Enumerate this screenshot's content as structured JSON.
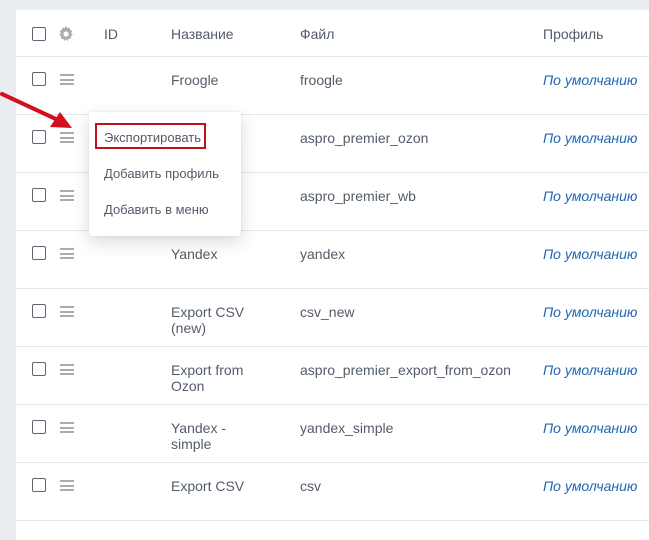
{
  "table": {
    "columns": {
      "id": "ID",
      "name": "Название",
      "file": "Файл",
      "profile": "Профиль"
    },
    "rows": [
      {
        "name": "Froogle",
        "file": "froogle",
        "profile": "По умолчанию"
      },
      {
        "name": "",
        "file": "aspro_premier_ozon",
        "profile": "По умолчанию"
      },
      {
        "name": "",
        "file": "aspro_premier_wb",
        "profile": "По умолчанию"
      },
      {
        "name": "Yandex",
        "file": "yandex",
        "profile": "По умолчанию"
      },
      {
        "name": "Export CSV (new)",
        "file": "csv_new",
        "profile": "По умолчанию"
      },
      {
        "name": "Export from Ozon",
        "file": "aspro_premier_export_from_ozon",
        "profile": "По умолчанию"
      },
      {
        "name": "Yandex - simple",
        "file": "yandex_simple",
        "profile": "По умолчанию"
      },
      {
        "name": "Export CSV",
        "file": "csv",
        "profile": "По умолчанию"
      }
    ]
  },
  "context_menu": {
    "items": [
      "Экспортировать",
      "Добавить профиль",
      "Добавить в меню"
    ]
  },
  "colors": {
    "accent_link": "#2067b0",
    "highlight_border": "#c0101b",
    "arrow": "#d0101c"
  },
  "icons": {
    "gear": "gear-icon",
    "drag": "drag-handle-icon",
    "arrow": "pointer-arrow-icon"
  }
}
